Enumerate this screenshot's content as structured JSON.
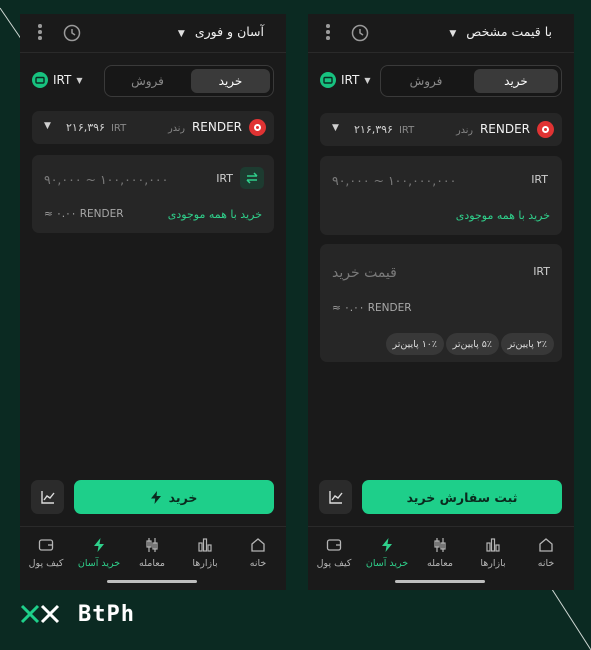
{
  "left": {
    "mode_label": "آسان و فوری",
    "currency": "IRT",
    "tabs": {
      "buy": "خرید",
      "sell": "فروش"
    },
    "asset": {
      "symbol": "RENDER",
      "name_fa": "رندر",
      "price": "۲۱۶,۳۹۶",
      "price_unit": "IRT"
    },
    "amount": {
      "placeholder": "۹۰,۰۰۰ ~ ۱۰۰,۰۰۰,۰۰۰",
      "unit": "IRT",
      "buy_all": "خرید با همه موجودی",
      "approx": "≈ ۰.۰۰ RENDER"
    },
    "button_label": "خرید"
  },
  "right": {
    "mode_label": "با قیمت مشخص",
    "currency": "IRT",
    "tabs": {
      "buy": "خرید",
      "sell": "فروش"
    },
    "asset": {
      "symbol": "RENDER",
      "name_fa": "رندر",
      "price": "۲۱۶,۳۹۶",
      "price_unit": "IRT"
    },
    "amount": {
      "placeholder": "۹۰,۰۰۰ ~ ۱۰۰,۰۰۰,۰۰۰",
      "unit": "IRT",
      "buy_all": "خرید با همه موجودی"
    },
    "price": {
      "placeholder": "قیمت خرید",
      "unit": "IRT",
      "approx": "≈ ۰.۰۰ RENDER"
    },
    "chips": [
      "۲٪ پایین‌تر",
      "۵٪ پایین‌تر",
      "۱۰٪ پایین‌تر"
    ],
    "button_label": "ثبت سفارش خرید"
  },
  "tabbar": {
    "home": "خانه",
    "markets": "بازارها",
    "trade": "معامله",
    "easy_buy": "خرید آسان",
    "wallet": "کیف پول"
  },
  "logo": "BtPh",
  "colors": {
    "accent": "#1ecf8a",
    "background": "#0b2a22",
    "panel": "#1a1a1a",
    "coin": "#e03333"
  }
}
